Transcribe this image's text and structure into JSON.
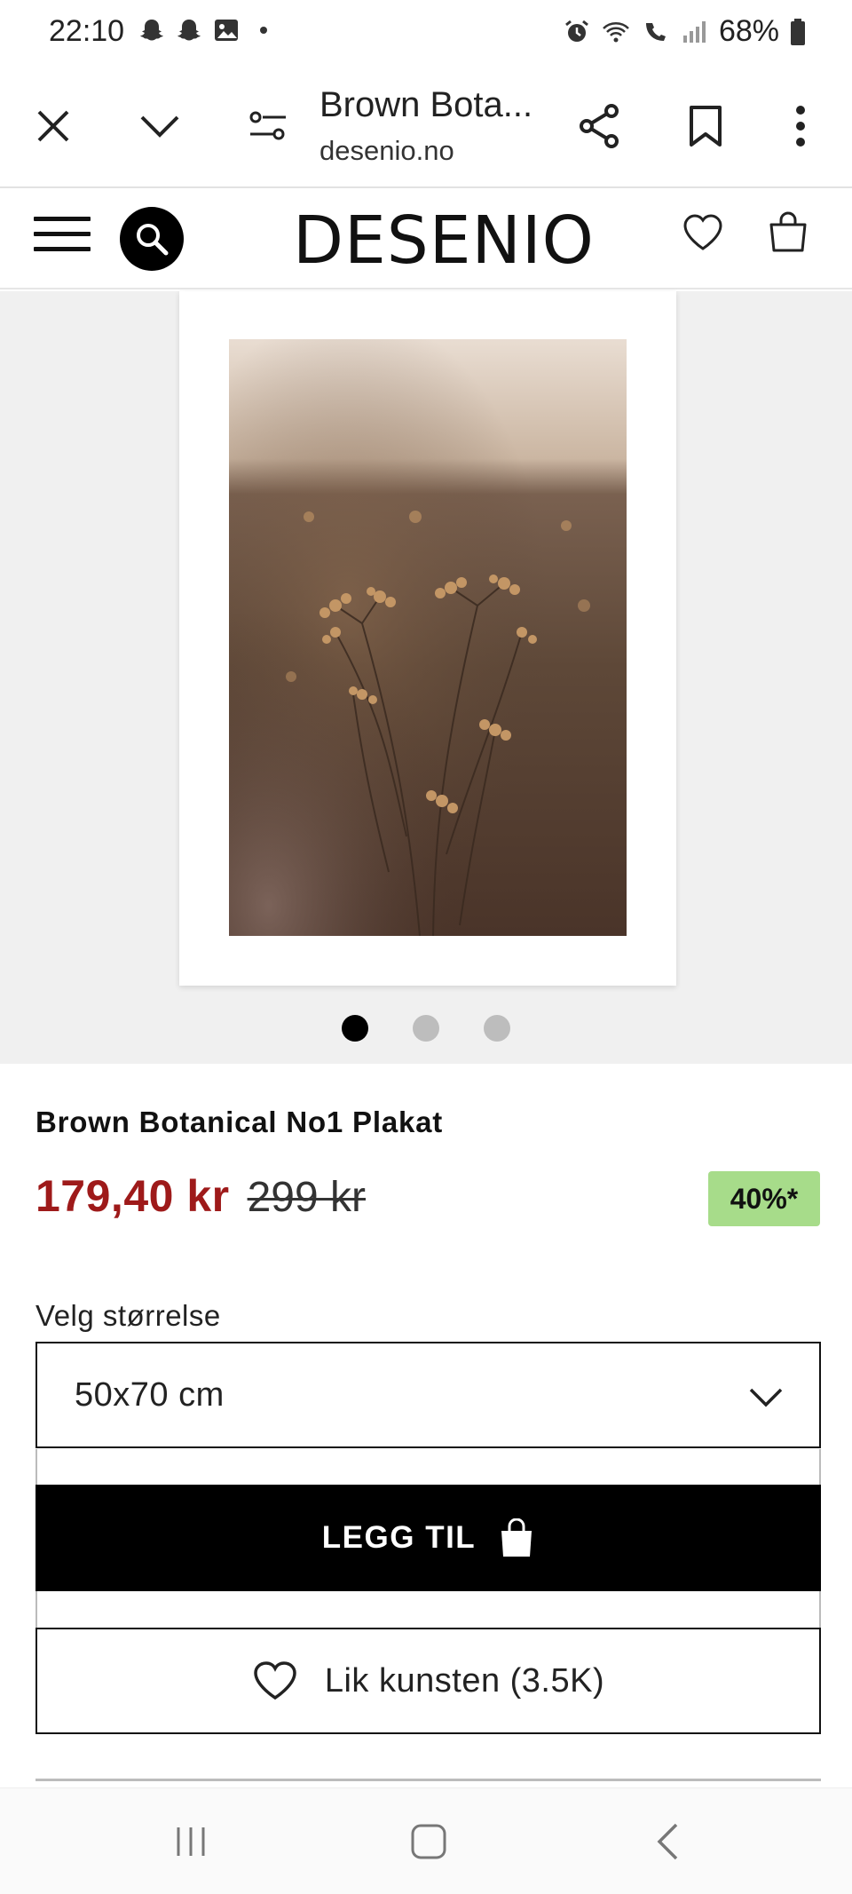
{
  "status_bar": {
    "time": "22:10",
    "battery": "68%",
    "left_icons": [
      "snapchat-icon",
      "snapchat-icon",
      "gallery-icon",
      "dot-icon"
    ],
    "right_icons": [
      "alarm-icon",
      "wifi-icon",
      "wifi-call-icon",
      "signal-icon",
      "battery-icon"
    ]
  },
  "browser": {
    "page_title": "Brown Bota...",
    "domain": "desenio.no",
    "icons": [
      "close-icon",
      "chevron-down-icon",
      "page-settings-icon",
      "share-icon",
      "bookmark-icon",
      "more-icon"
    ]
  },
  "site": {
    "logo": "DESENIO",
    "icons": [
      "menu-icon",
      "search-icon",
      "heart-icon",
      "bag-icon"
    ]
  },
  "gallery": {
    "image_count": 3,
    "active_index": 0
  },
  "product": {
    "title": "Brown Botanical No1 Plakat",
    "price_current": "179,40 kr",
    "price_original": "299 kr",
    "discount": "40%*",
    "price_color": "#9e1a1a",
    "discount_color": "#a7dc8a"
  },
  "size": {
    "label": "Velg størrelse",
    "selected": "50x70 cm"
  },
  "actions": {
    "add_to_cart": "LEGG TIL",
    "like": "Lik kunsten (3.5K)"
  },
  "nav": {
    "icons": [
      "recent-apps-icon",
      "home-icon",
      "back-icon"
    ]
  }
}
